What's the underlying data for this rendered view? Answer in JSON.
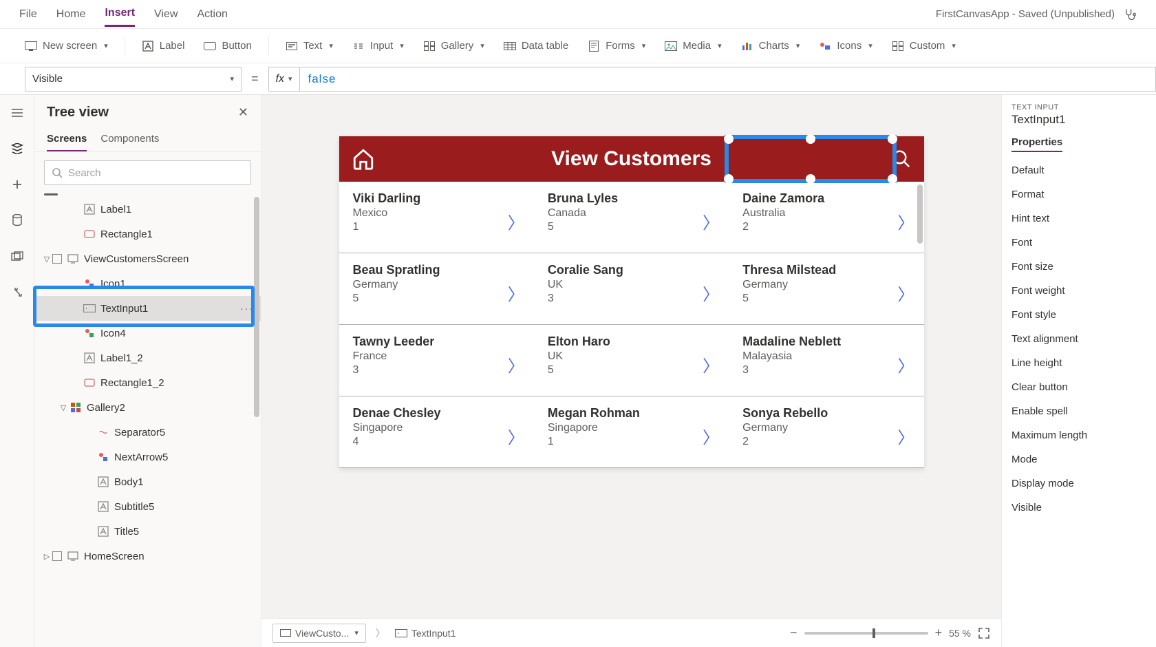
{
  "menubar": {
    "items": [
      "File",
      "Home",
      "Insert",
      "View",
      "Action"
    ],
    "active_index": 2,
    "doc_title": "FirstCanvasApp - Saved (Unpublished)"
  },
  "ribbon": {
    "new_screen": "New screen",
    "label": "Label",
    "button": "Button",
    "text": "Text",
    "input": "Input",
    "gallery": "Gallery",
    "data_table": "Data table",
    "forms": "Forms",
    "media": "Media",
    "charts": "Charts",
    "icons": "Icons",
    "custom": "Custom"
  },
  "formula": {
    "property": "Visible",
    "fx": "fx",
    "value": "false"
  },
  "tree": {
    "title": "Tree view",
    "tabs": [
      "Screens",
      "Components"
    ],
    "active_tab": 0,
    "search_placeholder": "Search",
    "nodes": [
      {
        "indent": 2,
        "icon": "label",
        "label": "Label1"
      },
      {
        "indent": 2,
        "icon": "rect",
        "label": "Rectangle1"
      },
      {
        "indent": 0,
        "icon": "screen",
        "label": "ViewCustomersScreen",
        "expanded": true,
        "checkbox": true
      },
      {
        "indent": 2,
        "icon": "iconctrl",
        "label": "Icon1"
      },
      {
        "indent": 2,
        "icon": "textinput",
        "label": "TextInput1",
        "selected": true,
        "more": true
      },
      {
        "indent": 2,
        "icon": "iconadd",
        "label": "Icon4"
      },
      {
        "indent": 2,
        "icon": "label",
        "label": "Label1_2"
      },
      {
        "indent": 2,
        "icon": "rect",
        "label": "Rectangle1_2"
      },
      {
        "indent": 1,
        "icon": "gallery",
        "label": "Gallery2",
        "expanded": true
      },
      {
        "indent": 3,
        "icon": "sep",
        "label": "Separator5"
      },
      {
        "indent": 3,
        "icon": "arrow",
        "label": "NextArrow5"
      },
      {
        "indent": 3,
        "icon": "label",
        "label": "Body1"
      },
      {
        "indent": 3,
        "icon": "label",
        "label": "Subtitle5"
      },
      {
        "indent": 3,
        "icon": "label",
        "label": "Title5"
      },
      {
        "indent": 0,
        "icon": "screen",
        "label": "HomeScreen",
        "expanded": false,
        "checkbox": true
      }
    ]
  },
  "preview": {
    "header_title": "View Customers",
    "cells": [
      {
        "name": "Viki Darling",
        "sub": "Mexico",
        "num": "1"
      },
      {
        "name": "Bruna Lyles",
        "sub": "Canada",
        "num": "5"
      },
      {
        "name": "Daine Zamora",
        "sub": "Australia",
        "num": "2"
      },
      {
        "name": "Beau Spratling",
        "sub": "Germany",
        "num": "5"
      },
      {
        "name": "Coralie Sang",
        "sub": "UK",
        "num": "3"
      },
      {
        "name": "Thresa Milstead",
        "sub": "Germany",
        "num": "5"
      },
      {
        "name": "Tawny Leeder",
        "sub": "France",
        "num": "3"
      },
      {
        "name": "Elton Haro",
        "sub": "UK",
        "num": "5"
      },
      {
        "name": "Madaline Neblett",
        "sub": "Malayasia",
        "num": "3"
      },
      {
        "name": "Denae Chesley",
        "sub": "Singapore",
        "num": "4"
      },
      {
        "name": "Megan Rohman",
        "sub": "Singapore",
        "num": "1"
      },
      {
        "name": "Sonya Rebello",
        "sub": "Germany",
        "num": "2"
      }
    ]
  },
  "footer": {
    "breadcrumb1": "ViewCusto...",
    "breadcrumb2": "TextInput1",
    "zoom_pct": "55 %"
  },
  "properties": {
    "category": "TEXT INPUT",
    "object": "TextInput1",
    "tab": "Properties",
    "rows": [
      "Default",
      "Format",
      "Hint text",
      "Font",
      "Font size",
      "Font weight",
      "Font style",
      "Text alignment",
      "Line height",
      "Clear button",
      "Enable spell",
      "Maximum length",
      "Mode",
      "Display mode",
      "Visible"
    ]
  },
  "colors": {
    "brand": "#9a1c1c",
    "accent": "#742774",
    "select": "#2889e9"
  }
}
